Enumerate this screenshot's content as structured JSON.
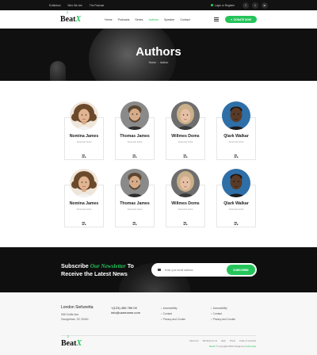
{
  "topbar": {
    "links": [
      "Exhibitors",
      "Who We Are",
      "The Podcast"
    ],
    "login": "Login or Register",
    "social": [
      "f",
      "t",
      "in"
    ]
  },
  "header": {
    "logo_main": "Beat",
    "logo_accent": "X",
    "nav": [
      "Home",
      "Podcasts",
      "Series",
      "Authors",
      "Speaker",
      "Contact"
    ],
    "active_nav": "Authors",
    "donate": "DONATE NOW"
  },
  "hero": {
    "title": "Authors",
    "breadcrumb": [
      "Home",
      "Author"
    ]
  },
  "authors": [
    {
      "name": "Nomina James",
      "role": "Scientist Artist",
      "photo": "woman-curly"
    },
    {
      "name": "Thomas James",
      "role": "Scientist Artist",
      "photo": "man-beard"
    },
    {
      "name": "Willmes Doms",
      "role": "Scientist Artist",
      "photo": "woman-blonde"
    },
    {
      "name": "Qlark Walkar",
      "role": "Scientist Artist",
      "photo": "man-dark"
    },
    {
      "name": "Nomina James",
      "role": "Scientist Artist",
      "photo": "woman-curly"
    },
    {
      "name": "Thomas James",
      "role": "Scientist Artist",
      "photo": "man-beard"
    },
    {
      "name": "Willmes Doms",
      "role": "Scientist Artist",
      "photo": "woman-blonde"
    },
    {
      "name": "Qlark Walkar",
      "role": "Scientist Artist",
      "photo": "man-dark"
    }
  ],
  "subscribe": {
    "title_pre": "Subscribe",
    "title_highlight": "Our Newsletter",
    "title_post": "To",
    "title_line2": "Receive the Latest News",
    "placeholder": "Enter your email address",
    "button": "SUBSCRIBE"
  },
  "footer": {
    "city": "London Siefunetta",
    "address_lines": [
      "906 Orville Ave.",
      "Georgetown, SC 29440"
    ],
    "phone": "+(123) 456 789 00",
    "email": "info@username.com",
    "col1": [
      "Accessibility",
      "Contact",
      "Privacy and Cookie"
    ],
    "col2": [
      "Accessibility",
      "Contact",
      "Privacy and Cookie"
    ],
    "bottom_links": [
      "About Us",
      "Working for Us",
      "Help",
      "Press",
      "Code of Conduct"
    ],
    "copy_pre": "BeatX",
    "copy_mid": "© Copyright 2020. Design by",
    "copy_brand": "Softnovska"
  },
  "colors": {
    "accent": "#25c45a",
    "dark": "#121212"
  }
}
